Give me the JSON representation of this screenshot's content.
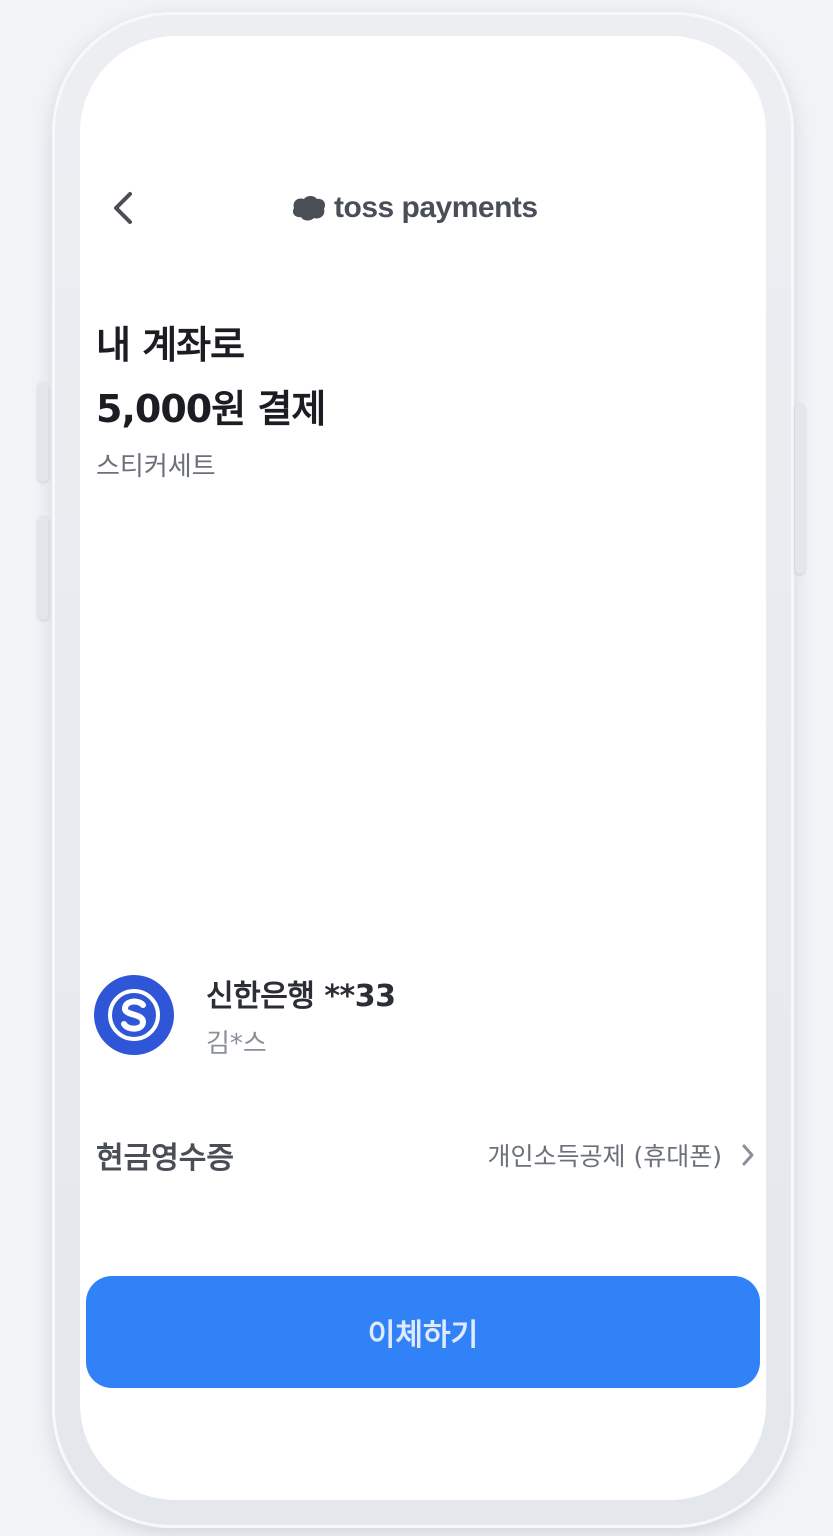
{
  "header": {
    "logo_text": "toss payments",
    "back_icon": "chevron-left-icon"
  },
  "title": {
    "line1": "내 계좌로",
    "line2": "5,000원 결제"
  },
  "product": {
    "name": "스티커세트"
  },
  "account": {
    "bank_icon": "shinhan-bank-icon",
    "bank_color": "#2f56d6",
    "name": "신한은행 **33",
    "holder": "김*스"
  },
  "receipt": {
    "label": "현금영수증",
    "value": "개인소득공제 (휴대폰)",
    "chevron_icon": "chevron-right-icon"
  },
  "action": {
    "pay_label": "이체하기",
    "accent_color": "#3182f6"
  }
}
